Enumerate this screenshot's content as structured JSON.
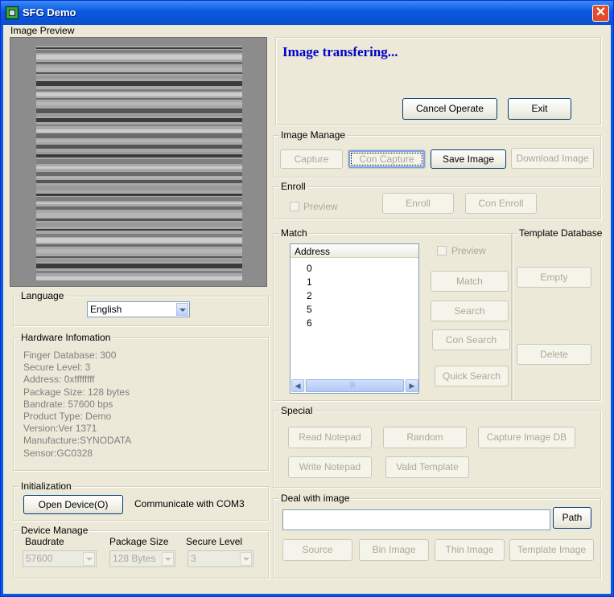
{
  "window": {
    "title": "SFG Demo"
  },
  "preview": {
    "title": "Image Preview"
  },
  "status": {
    "message": "Image transfering...",
    "message_color": "#0000cc"
  },
  "top_buttons": {
    "cancel": "Cancel Operate",
    "exit": "Exit"
  },
  "image_manage": {
    "title": "Image Manage",
    "capture": "Capture",
    "con_capture": "Con Capture",
    "save_image": "Save Image",
    "download_image": "Download Image"
  },
  "enroll": {
    "title": "Enroll",
    "preview": "Preview",
    "enroll": "Enroll",
    "con_enroll": "Con Enroll"
  },
  "match": {
    "title": "Match",
    "address_header": "Address",
    "addresses": [
      "0",
      "1",
      "2",
      "5",
      "6"
    ],
    "preview": "Preview",
    "match": "Match",
    "search": "Search",
    "con_search": "Con Search",
    "quick_search": "Quick Search"
  },
  "template_db": {
    "title": "Template Database",
    "empty": "Empty",
    "delete": "Delete"
  },
  "language": {
    "title": "Language",
    "value": "English"
  },
  "hardware": {
    "title": "Hardware Infomation",
    "lines": [
      "Finger Database: 300",
      "Secure Level: 3",
      "Address: 0xffffffff",
      "Package Size: 128 bytes",
      "Bandrate: 57600 bps",
      "Product Type:  Demo",
      "Version:Ver 1371",
      "Manufacture:SYNODATA",
      "Sensor:GC0328"
    ]
  },
  "special": {
    "title": "Special",
    "read_notepad": "Read Notepad",
    "random": "Random",
    "capture_image_db": "Capture Image DB",
    "write_notepad": "Write Notepad",
    "valid_template": "Valid Template"
  },
  "initialization": {
    "title": "Initialization",
    "open_device": "Open Device(O)",
    "communicate": "Communicate with COM3"
  },
  "deal": {
    "title": "Deal with image",
    "path_value": "",
    "path": "Path",
    "source": "Source",
    "bin_image": "Bin Image",
    "thin_image": "Thin Image",
    "template_image": "Template Image"
  },
  "device_manage": {
    "title": "Device Manage",
    "baudrate_label": "Baudrate",
    "baudrate_value": "57600",
    "package_label": "Package Size",
    "package_value": "128 Bytes",
    "secure_label": "Secure Level",
    "secure_value": "3"
  }
}
